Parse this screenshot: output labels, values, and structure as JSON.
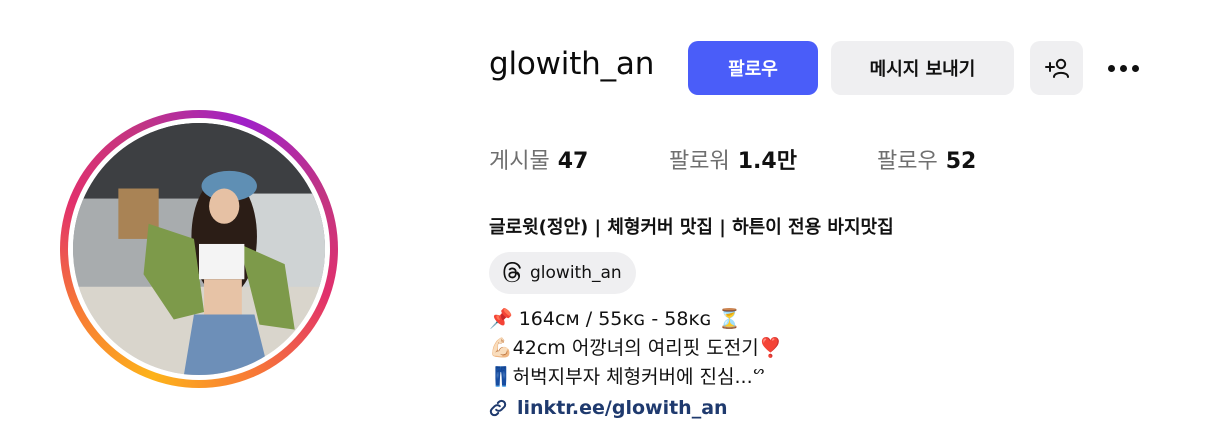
{
  "profile": {
    "username": "glowith_an",
    "full_name": "글로윗(정안) | 체형커버 맛집 | 하튼이 전용 바지맛집",
    "threads_handle": "glowith_an",
    "link": "linktr.ee/glowith_an"
  },
  "actions": {
    "follow_label": "팔로우",
    "message_label": "메시지 보내기",
    "add_user_icon": "add-person-icon",
    "more_icon": "more-dots-icon"
  },
  "stats": {
    "posts_label": "게시물",
    "posts_value": "47",
    "followers_label": "팔로워",
    "followers_value": "1.4만",
    "following_label": "팔로우",
    "following_value": "52"
  },
  "bio": {
    "line1": "📌 164cᴍ / 55ᴋɢ - 58ᴋɢ ⏳",
    "line2": "💪🏻42cm 어깡녀의 여리핏 도전기❣️",
    "line3": "👖허벅지부자 체형커버에 진심...ᔥ"
  },
  "colors": {
    "follow_button": "#4a5df9",
    "secondary_button": "#efeff1",
    "link": "#1f3a6e"
  }
}
